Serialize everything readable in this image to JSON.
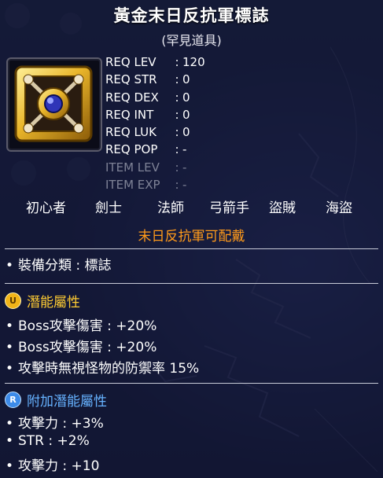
{
  "item": {
    "name": "黃金末日反抗軍標誌",
    "rarity": "(罕見道具)"
  },
  "requirements": [
    {
      "label": "REQ LEV",
      "value": "120",
      "dim": false
    },
    {
      "label": "REQ STR",
      "value": "0",
      "dim": false
    },
    {
      "label": "REQ DEX",
      "value": "0",
      "dim": false
    },
    {
      "label": "REQ INT",
      "value": "0",
      "dim": false
    },
    {
      "label": "REQ LUK",
      "value": "0",
      "dim": false
    },
    {
      "label": "REQ POP",
      "value": "-",
      "dim": false
    },
    {
      "label": "ITEM LEV",
      "value": "-",
      "dim": true
    },
    {
      "label": "ITEM EXP",
      "value": "-",
      "dim": true
    }
  ],
  "jobs": [
    "初心者",
    "劍士",
    "法師",
    "弓箭手",
    "盜賊",
    "海盜"
  ],
  "equip_restriction": "末日反抗軍可配戴",
  "category_line": "裝備分類 : 標誌",
  "potential": {
    "badge": "U",
    "heading": "潛能屬性",
    "lines": [
      "Boss攻擊傷害 : +20%",
      "Boss攻擊傷害 : +20%",
      "攻擊時無視怪物的防禦率 15%"
    ]
  },
  "bonus_potential": {
    "badge": "R",
    "heading": "附加潛能屬性",
    "lines": [
      "攻擊力 : +3%",
      "STR : +2%",
      "攻擊力 : +10"
    ]
  },
  "colors": {
    "equip_note": "#ff9a1a",
    "potential_heading": "#ffcc33",
    "bonus_heading": "#66b2ff",
    "dim_text": "#7e8296"
  },
  "icon": {
    "name": "golden-apocalypse-resistance-emblem-icon"
  },
  "bullet": "•"
}
